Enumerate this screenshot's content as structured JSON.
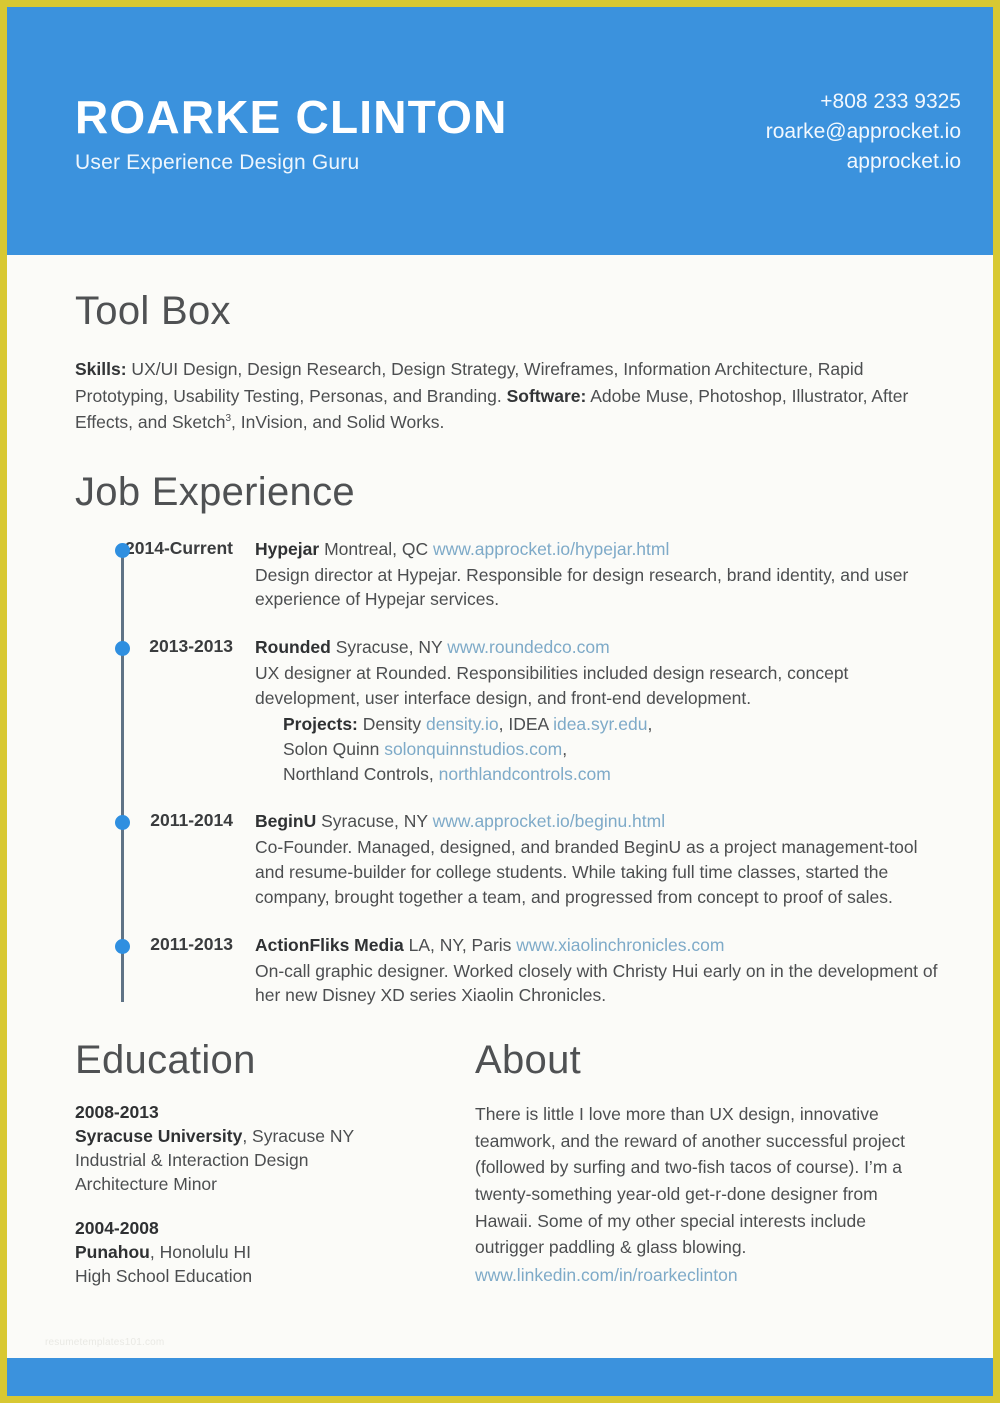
{
  "header": {
    "name": "ROARKE CLINTON",
    "tagline": "User Experience Design Guru",
    "contact": {
      "phone": "+808 233 9325",
      "email": "roarke@approcket.io",
      "website": "approcket.io"
    }
  },
  "toolbox": {
    "title": "Tool Box",
    "skills_label": "Skills:",
    "skills_text": " UX/UI Design, Design Research, Design Strategy, Wireframes, Information Architecture, Rapid Prototyping, Usability Testing, Personas, and Branding. ",
    "software_label": "Software:",
    "software_text_before_sketch": " Adobe Muse, Photoshop, Illustrator, After Effects, and Sketch",
    "sketch_superscript": "3",
    "software_text_after_sketch": ", InVision, and Solid Works."
  },
  "job_experience": {
    "title": "Job Experience",
    "jobs": [
      {
        "years": "2014-Current",
        "company": "Hypejar",
        "place": " Montreal, QC  ",
        "link": "www.approcket.io/hypejar.html",
        "description": "Design director at Hypejar. Responsible for design research, brand identity, and user experience of Hypejar services."
      },
      {
        "years": "2013-2013",
        "company": "Rounded",
        "place": " Syracuse, NY  ",
        "link": "www.roundedco.com",
        "description": "UX designer at Rounded. Responsibilities included design research, concept development, user interface design, and front-end development.",
        "projects_label": "Projects:",
        "projects_lines": [
          {
            "pre": "  Density ",
            "link": "density.io",
            "mid": ", IDEA ",
            "link2": "idea.syr.edu",
            "post": ","
          },
          {
            "pre": "Solon Quinn ",
            "link": "solonquinnstudios.com",
            "post": ","
          },
          {
            "pre": "Northland Controls, ",
            "link": "northlandcontrols.com",
            "post": ""
          }
        ]
      },
      {
        "years": "2011-2014",
        "company": "BeginU",
        "place": " Syracuse, NY  ",
        "link": "www.approcket.io/beginu.html",
        "description": "Co-Founder. Managed, designed, and branded BeginU as a project management-tool and resume-builder for college students. While taking full time classes, started the company, brought together a team, and progressed from concept to proof of sales."
      },
      {
        "years": "2011-2013",
        "company": "ActionFliks Media",
        "place": " LA, NY, Paris  ",
        "link": "www.xiaolinchronicles.com",
        "description": "On-call graphic designer. Worked closely with Christy Hui early on in the development of her new Disney XD series Xiaolin Chronicles."
      }
    ]
  },
  "education": {
    "title": "Education",
    "entries": [
      {
        "years": "2008-2013",
        "school": "Syracuse University",
        "location": ", Syracuse NY",
        "detail1": "Industrial & Interaction Design",
        "detail2": "Architecture Minor"
      },
      {
        "years": "2004-2008",
        "school": "Punahou",
        "location": ", Honolulu HI",
        "detail1": "High School Education",
        "detail2": ""
      }
    ]
  },
  "about": {
    "title": "About",
    "text": "There is little I love more than UX design, innovative teamwork, and the reward of another successful project (followed by surfing and two-fish tacos of course). I’m a twenty-something year-old get-r-done designer from Hawaii. Some of my other special interests include outrigger paddling & glass blowing.",
    "link": "www.linkedin.com/in/roarkeclinton"
  },
  "watermark": "resumetemplates101.com",
  "colors": {
    "accent_blue": "#3b92dd",
    "border_yellow": "#d8c832",
    "link_blue": "#7eaac8",
    "timeline_dot": "#2f8fe0",
    "timeline_rail": "#5f7386",
    "page_background": "#fbfbf8",
    "heading_gray": "#4f5153",
    "body_gray": "#4c4e50"
  }
}
